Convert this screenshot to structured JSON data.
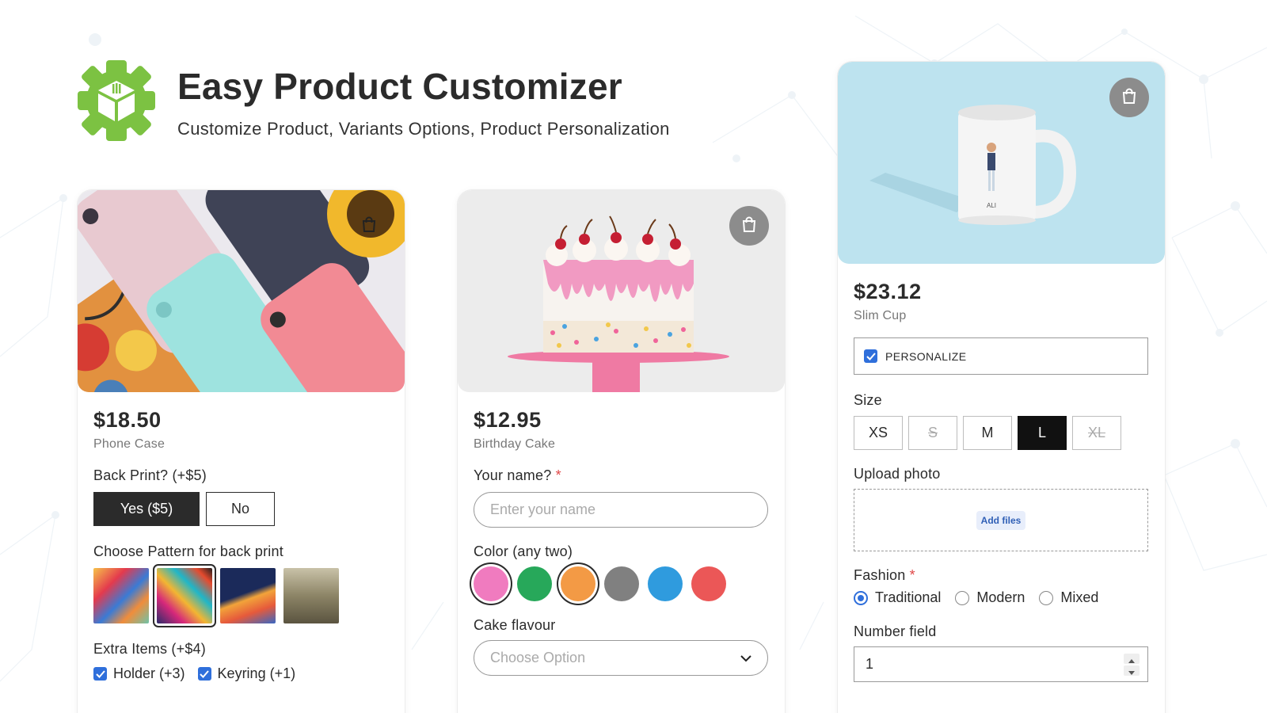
{
  "header": {
    "title": "Easy Product Customizer",
    "subtitle": "Customize Product, Variants Options, Product Personalization",
    "logo_icon": "gear-box-icon",
    "logo_color": "#7cc242"
  },
  "cards": [
    {
      "price": "$18.50",
      "name": "Phone Case",
      "bag_icon": "shopping-bag-icon",
      "back_print": {
        "label": "Back Print? (+$5)",
        "options": [
          "Yes ($5)",
          "No"
        ],
        "selected": "Yes ($5)"
      },
      "pattern": {
        "label": "Choose Pattern for back print",
        "selected_index": 1
      },
      "extras": {
        "label": "Extra Items (+$4)",
        "items": [
          {
            "label": "Holder (+3)",
            "checked": true
          },
          {
            "label": "Keyring (+1)",
            "checked": true
          }
        ]
      }
    },
    {
      "price": "$12.95",
      "name": "Birthday Cake",
      "bag_icon": "shopping-bag-icon",
      "name_field": {
        "label": "Your name?",
        "required_mark": "*",
        "placeholder": "Enter your name"
      },
      "color": {
        "label": "Color (any two)",
        "swatches": [
          "#f07bbf",
          "#27a85a",
          "#f39a45",
          "#808080",
          "#2f9bde",
          "#eb5757"
        ],
        "selected": [
          0,
          2
        ]
      },
      "flavour": {
        "label": "Cake flavour",
        "placeholder": "Choose Option"
      }
    },
    {
      "price": "$23.12",
      "name": "Slim Cup",
      "bag_icon": "shopping-bag-icon",
      "personalize": {
        "label": "PERSONALIZE",
        "checked": true
      },
      "size": {
        "label": "Size",
        "options": [
          "XS",
          "S",
          "M",
          "L",
          "XL"
        ],
        "selected": "L",
        "unavailable": [
          "S",
          "XL"
        ]
      },
      "upload": {
        "label": "Upload photo",
        "button": "Add files"
      },
      "fashion": {
        "label": "Fashion",
        "required_mark": "*",
        "options": [
          "Traditional",
          "Modern",
          "Mixed"
        ],
        "selected": "Traditional"
      },
      "number": {
        "label": "Number field",
        "value": "1"
      },
      "mug_print_text": "ALI"
    }
  ],
  "colors": {
    "accent_blue": "#2f6fdb",
    "dark": "#2b2b2b",
    "required_red": "#e04848"
  }
}
